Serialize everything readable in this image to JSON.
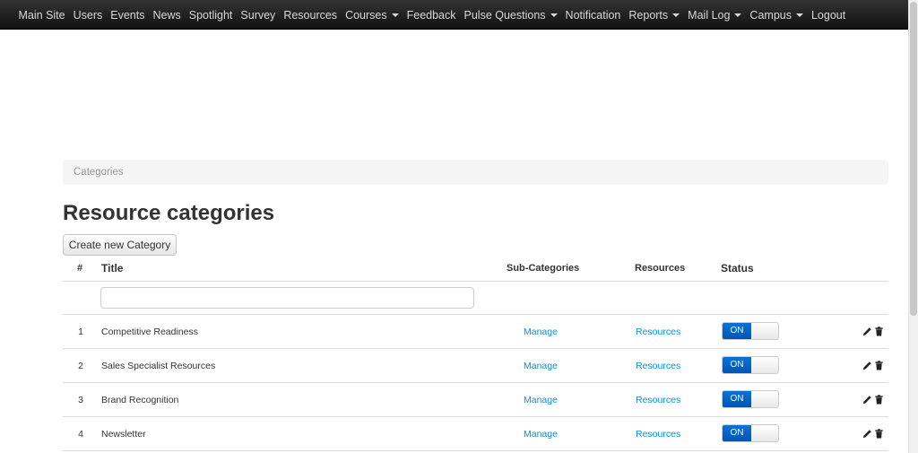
{
  "navbar": {
    "items": [
      {
        "label": "Main Site",
        "dropdown": false
      },
      {
        "label": "Users",
        "dropdown": false
      },
      {
        "label": "Events",
        "dropdown": false
      },
      {
        "label": "News",
        "dropdown": false
      },
      {
        "label": "Spotlight",
        "dropdown": false
      },
      {
        "label": "Survey",
        "dropdown": false
      },
      {
        "label": "Resources",
        "dropdown": false
      },
      {
        "label": "Courses",
        "dropdown": true
      },
      {
        "label": "Feedback",
        "dropdown": false
      },
      {
        "label": "Pulse Questions",
        "dropdown": true
      },
      {
        "label": "Notification",
        "dropdown": false
      },
      {
        "label": "Reports",
        "dropdown": true
      },
      {
        "label": "Mail Log",
        "dropdown": true
      },
      {
        "label": "Campus",
        "dropdown": true
      },
      {
        "label": "Logout",
        "dropdown": false
      }
    ]
  },
  "breadcrumb": {
    "current": "Categories"
  },
  "page": {
    "title": "Resource categories",
    "create_button": "Create new Category"
  },
  "table": {
    "headers": {
      "num": "#",
      "title": "Title",
      "subcategories": "Sub-Categories",
      "resources": "Resources",
      "status": "Status"
    },
    "filter_value": "",
    "rows": [
      {
        "num": "1",
        "title": "Competitive Readiness",
        "manage": "Manage",
        "resources": "Resources",
        "status": "ON"
      },
      {
        "num": "2",
        "title": "Sales Specialist Resources",
        "manage": "Manage",
        "resources": "Resources",
        "status": "ON"
      },
      {
        "num": "3",
        "title": "Brand Recognition",
        "manage": "Manage",
        "resources": "Resources",
        "status": "ON"
      },
      {
        "num": "4",
        "title": "Newsletter",
        "manage": "Manage",
        "resources": "Resources",
        "status": "ON"
      }
    ]
  },
  "icons": {
    "edit": "pencil-icon",
    "delete": "trash-icon"
  },
  "colors": {
    "link": "#0a8fd1",
    "toggle_on": "#0054b4",
    "navbar": "#1a1a1a"
  }
}
